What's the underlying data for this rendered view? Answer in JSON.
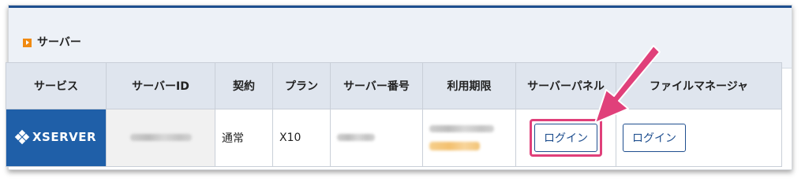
{
  "section": {
    "title": "サーバー"
  },
  "table": {
    "headers": [
      "サービス",
      "サーバーID",
      "契約",
      "プラン",
      "サーバー番号",
      "利用期限",
      "サーバーパネル",
      "ファイルマネージャ"
    ],
    "row": {
      "service_logo": "XSERVER",
      "contract": "通常",
      "plan": "X10",
      "server_panel_button": "ログイン",
      "file_manager_button": "ログイン"
    }
  },
  "colors": {
    "header_bar": "#1e4f8f",
    "logo_bg": "#1f5fa8",
    "highlight": "#e0407a",
    "accent_icon": "#f08a12"
  },
  "icons": [
    "play-icon",
    "xserver-logo-icon",
    "pink-arrow-annotation"
  ]
}
